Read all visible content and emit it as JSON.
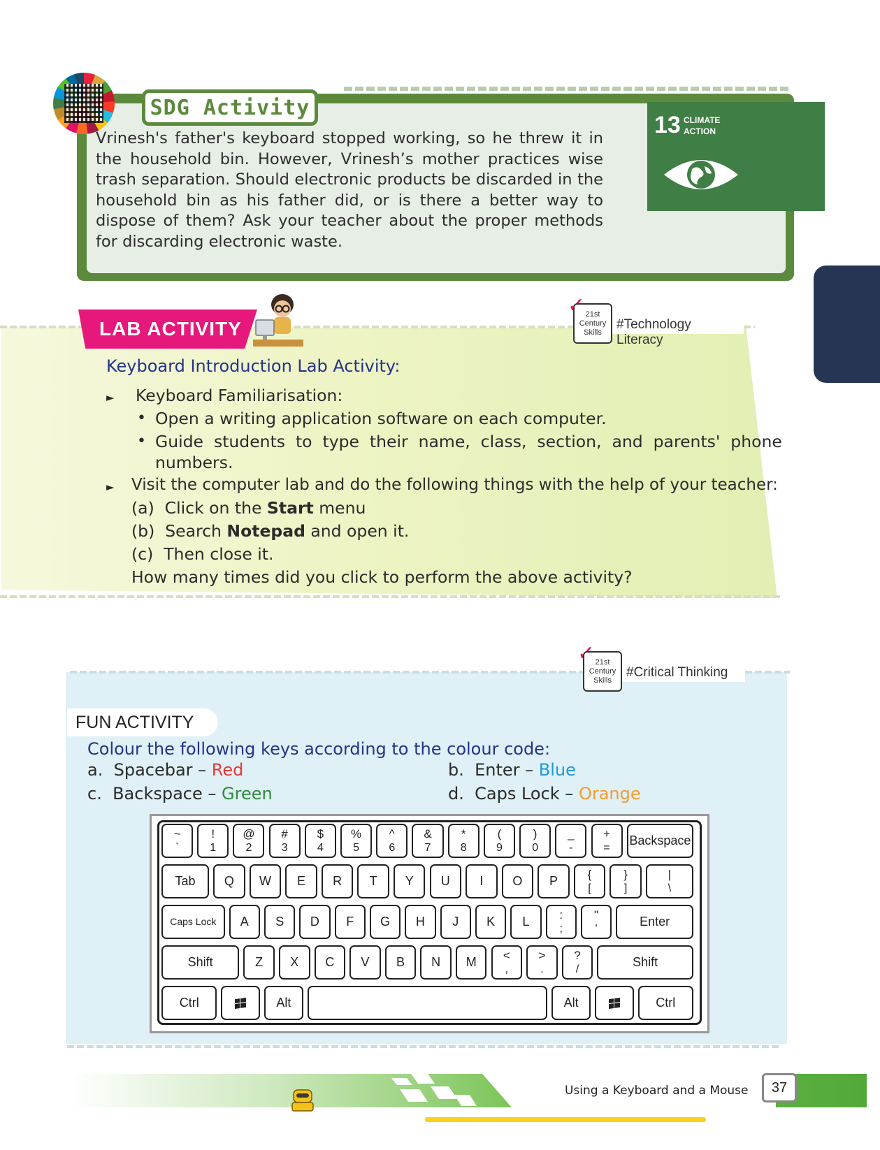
{
  "sdg": {
    "title": "SDG Activity",
    "text": "Vrinesh's father's keyboard stopped working, so he threw it in the household bin. However, Vrinesh’s mother practices wise trash separation. Should electronic products be discarded in the household bin as his father did, or is there a better way to dispose of them? Ask your teacher about the proper methods for discarding electronic waste.",
    "goal_number": "13",
    "goal_label_1": "CLIMATE",
    "goal_label_2": "ACTION",
    "goal_color": "#3f7e44",
    "goal_icon": "eye-earth-icon"
  },
  "lab": {
    "banner": "LAB ACTIVITY",
    "skill_top": "21st",
    "skill_mid": "Century",
    "skill_bot": "Skills",
    "skill_tag": "#Technology Literacy",
    "heading": "Keyboard Introduction Lab Activity:",
    "item1": "Keyboard Familiarisation:",
    "bullet1": "Open a writing application software on each computer.",
    "bullet2_line1": "Guide  students  to  type  their  name,  class,  section,  and  parents'  phone",
    "bullet2_line2": "numbers.",
    "item2": "Visit the computer lab and do the following things with the help of your teacher:",
    "step_a_pre": "(a)  Click on the ",
    "step_a_bold": "Start",
    "step_a_post": " menu",
    "step_b_pre": "(b)  Search ",
    "step_b_bold": "Notepad",
    "step_b_post": " and open it.",
    "step_c": "(c)  Then close it.",
    "question": "How many times did you click to perform the above activity?"
  },
  "fun": {
    "tab": "FUN ACTIVITY",
    "skill_top": "21st",
    "skill_mid": "Century",
    "skill_bot": "Skills",
    "skill_tag": "#Critical Thinking",
    "heading": "Colour the following keys according to the colour code:",
    "a_label": "a.  Spacebar – ",
    "a_color": "Red",
    "b_label": "b.  Enter – ",
    "b_color": "Blue",
    "c_label": "c.  Backspace – ",
    "c_color": "Green",
    "d_label": "d.  Caps Lock – ",
    "d_color": "Orange",
    "colors": {
      "red": "#e53935",
      "blue": "#1e9ad6",
      "green": "#2e8b3a",
      "orange": "#f39c33"
    }
  },
  "keyboard": {
    "row1": [
      {
        "top": "~",
        "bot": "`"
      },
      {
        "top": "!",
        "bot": "1"
      },
      {
        "top": "@",
        "bot": "2"
      },
      {
        "top": "#",
        "bot": "3"
      },
      {
        "top": "$",
        "bot": "4"
      },
      {
        "top": "%",
        "bot": "5"
      },
      {
        "top": "^",
        "bot": "6"
      },
      {
        "top": "&",
        "bot": "7"
      },
      {
        "top": "*",
        "bot": "8"
      },
      {
        "top": "(",
        "bot": "9"
      },
      {
        "top": ")",
        "bot": "0"
      },
      {
        "top": "_",
        "bot": "-"
      },
      {
        "top": "+",
        "bot": "="
      },
      {
        "mid": "Backspace"
      }
    ],
    "row2": [
      {
        "mid": "Tab"
      },
      {
        "mid": "Q"
      },
      {
        "mid": "W"
      },
      {
        "mid": "E"
      },
      {
        "mid": "R"
      },
      {
        "mid": "T"
      },
      {
        "mid": "Y"
      },
      {
        "mid": "U"
      },
      {
        "mid": "I"
      },
      {
        "mid": "O"
      },
      {
        "mid": "P"
      },
      {
        "top": "{",
        "bot": "["
      },
      {
        "top": "}",
        "bot": "]"
      },
      {
        "top": "|",
        "bot": "\\"
      }
    ],
    "row3": [
      {
        "mid": "Caps Lock"
      },
      {
        "mid": "A"
      },
      {
        "mid": "S"
      },
      {
        "mid": "D"
      },
      {
        "mid": "F"
      },
      {
        "mid": "G"
      },
      {
        "mid": "H"
      },
      {
        "mid": "J"
      },
      {
        "mid": "K"
      },
      {
        "mid": "L"
      },
      {
        "top": ":",
        "bot": ";"
      },
      {
        "top": "\"",
        "bot": "'"
      },
      {
        "mid": "Enter"
      }
    ],
    "row4": [
      {
        "mid": "Shift"
      },
      {
        "mid": "Z"
      },
      {
        "mid": "X"
      },
      {
        "mid": "C"
      },
      {
        "mid": "V"
      },
      {
        "mid": "B"
      },
      {
        "mid": "N"
      },
      {
        "mid": "M"
      },
      {
        "top": "<",
        "bot": ","
      },
      {
        "top": ">",
        "bot": "."
      },
      {
        "top": "?",
        "bot": "/"
      },
      {
        "mid": "Shift"
      }
    ],
    "row5": [
      {
        "mid": "Ctrl"
      },
      {
        "icon": "windows-icon"
      },
      {
        "mid": "Alt"
      },
      {
        "mid": ""
      },
      {
        "mid": "Alt"
      },
      {
        "icon": "windows-icon"
      },
      {
        "mid": "Ctrl"
      }
    ]
  },
  "footer": {
    "title": "Using a Keyboard and a Mouse",
    "page": "37"
  }
}
